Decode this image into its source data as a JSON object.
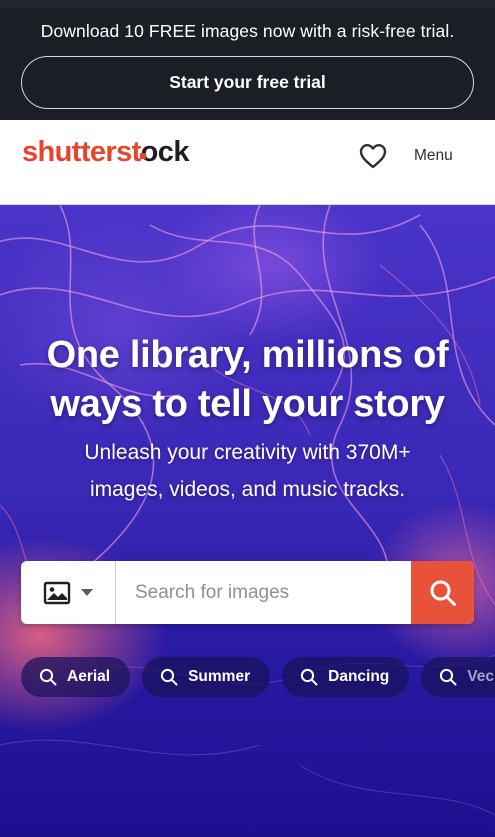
{
  "promo": {
    "text": "Download 10 FREE images now with a risk-free trial.",
    "cta_label": "Start your free trial"
  },
  "header": {
    "logo_part1": "shutterst",
    "logo_o": "o",
    "logo_part2": "ck",
    "menu_label": "Menu",
    "favorites_icon": "heart-outline-icon"
  },
  "hero": {
    "title_line1": "One library, millions of",
    "title_line2": "ways to tell your story",
    "subtitle_line1": "Unleash your creativity with 370M+",
    "subtitle_line2": "images, videos, and music tracks."
  },
  "search": {
    "type_icon": "image-icon",
    "placeholder": "Search for images",
    "value": "",
    "submit_icon": "search-icon"
  },
  "chips": [
    {
      "label": "Aerial"
    },
    {
      "label": "Summer"
    },
    {
      "label": "Dancing"
    },
    {
      "label": "Vec"
    }
  ],
  "colors": {
    "brand_red": "#e8432b",
    "banner_bg": "#1b1e24",
    "search_button": "#e8523a",
    "hero_purple": "#3a28b6"
  }
}
